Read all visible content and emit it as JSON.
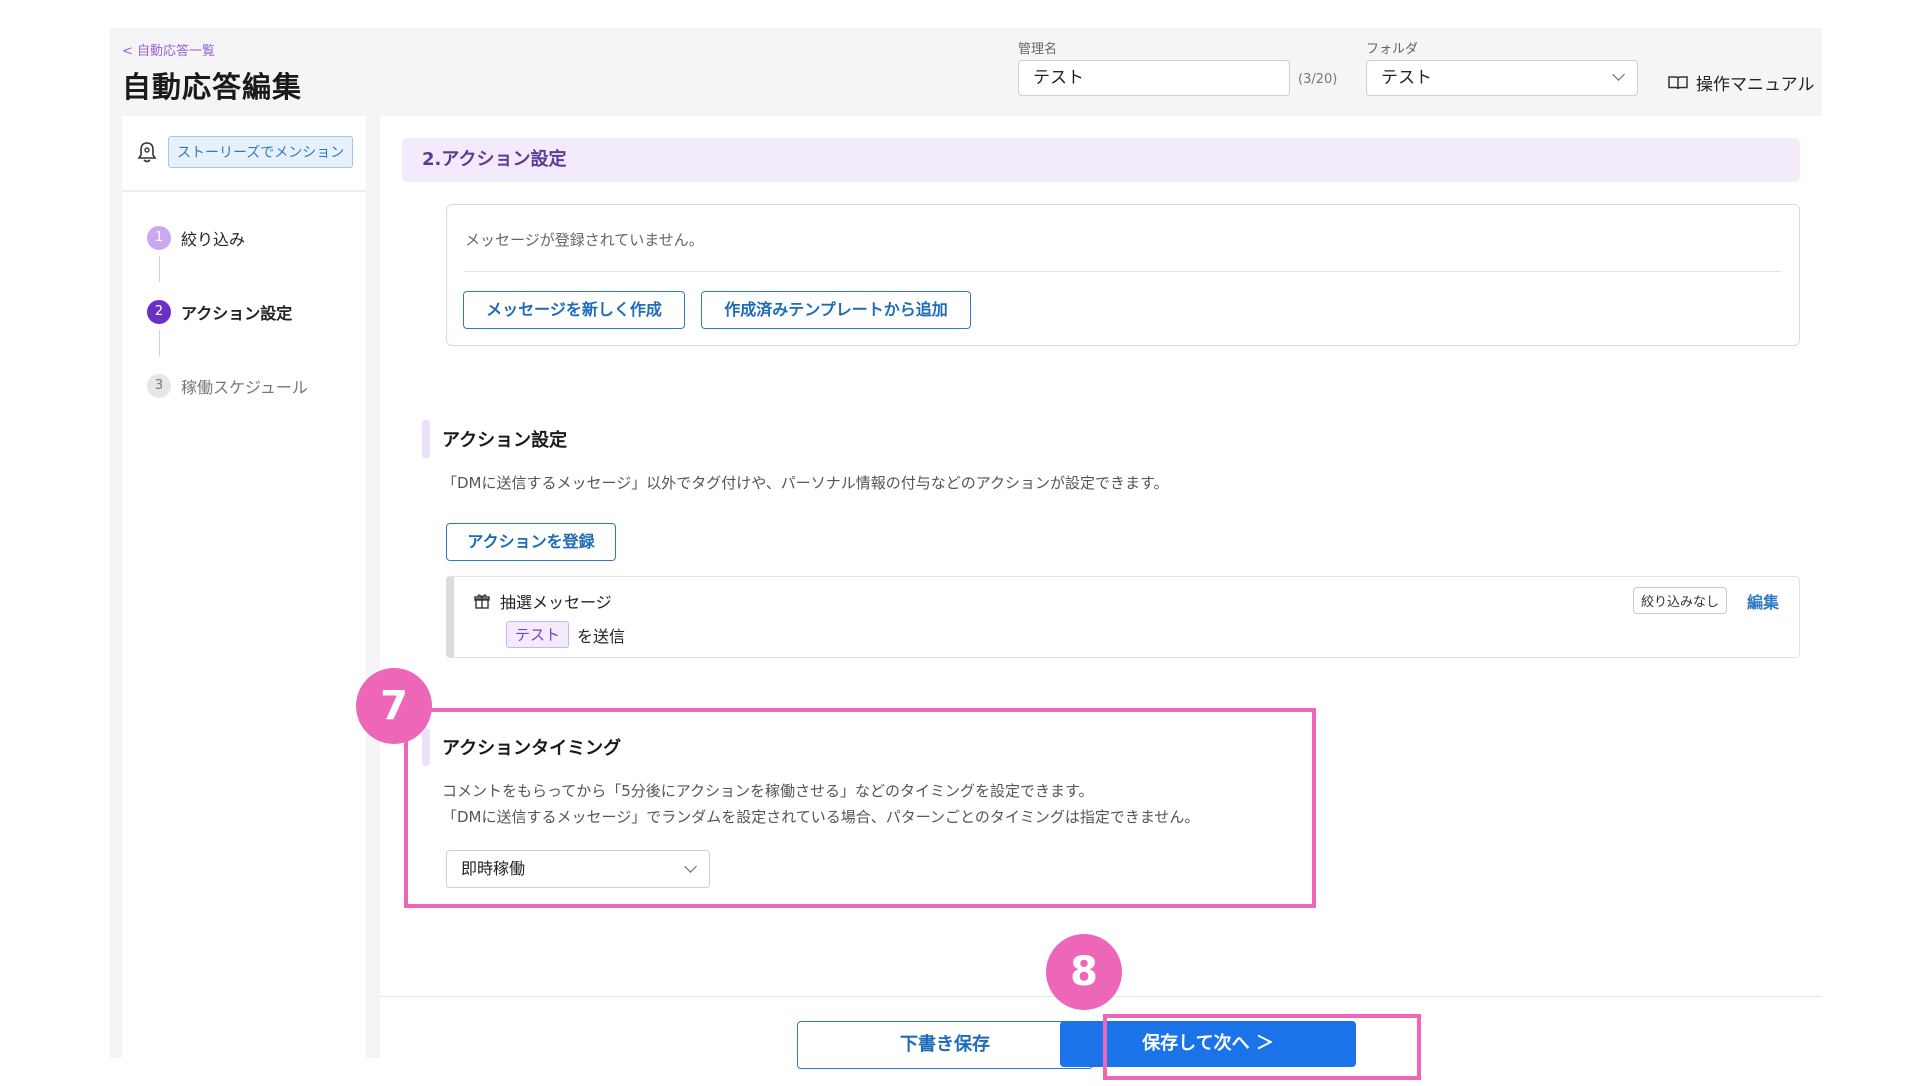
{
  "header": {
    "back_link": "< 自動応答一覧",
    "title": "自動応答編集",
    "name_label": "管理名",
    "name_value": "テスト",
    "name_counter": "(3/20)",
    "folder_label": "フォルダ",
    "folder_value": "テスト",
    "manual_label": "操作マニュアル"
  },
  "sidebar": {
    "trigger_tag": "ストーリーズでメンション",
    "steps": [
      {
        "num": "1",
        "label": "絞り込み"
      },
      {
        "num": "2",
        "label": "アクション設定"
      },
      {
        "num": "3",
        "label": "稼働スケジュール"
      }
    ]
  },
  "main": {
    "section_title": "2.アクション設定",
    "empty_message": "メッセージが登録されていません。",
    "new_message_button": "メッセージを新しく作成",
    "template_button": "作成済みテンプレートから追加",
    "action_settings": {
      "title": "アクション設定",
      "description": "「DMに送信するメッセージ」以外でタグ付けや、パーソナル情報の付与などのアクションが設定できます。",
      "register_button": "アクションを登録",
      "action_item": {
        "name": "抽選メッセージ",
        "value_tag": "テスト",
        "suffix": "を送信",
        "filter_badge": "絞り込みなし",
        "edit_link": "編集"
      }
    },
    "action_timing": {
      "title": "アクションタイミング",
      "description_1": "コメントをもらってから「5分後にアクションを稼働させる」などのタイミングを設定できます。",
      "description_2": "「DMに送信するメッセージ」でランダムを設定されている場合、パターンごとのタイミングは指定できません。",
      "select_value": "即時稼働"
    }
  },
  "footer": {
    "draft_button": "下書き保存",
    "next_button": "保存して次へ ＞"
  },
  "annotations": {
    "marker_7": "7",
    "marker_8": "8"
  },
  "colors": {
    "accent_blue": "#1a73e8",
    "highlight_pink": "#ee66b8",
    "step_active": "#6a2fc4",
    "section_bg": "#f3ebfc"
  }
}
